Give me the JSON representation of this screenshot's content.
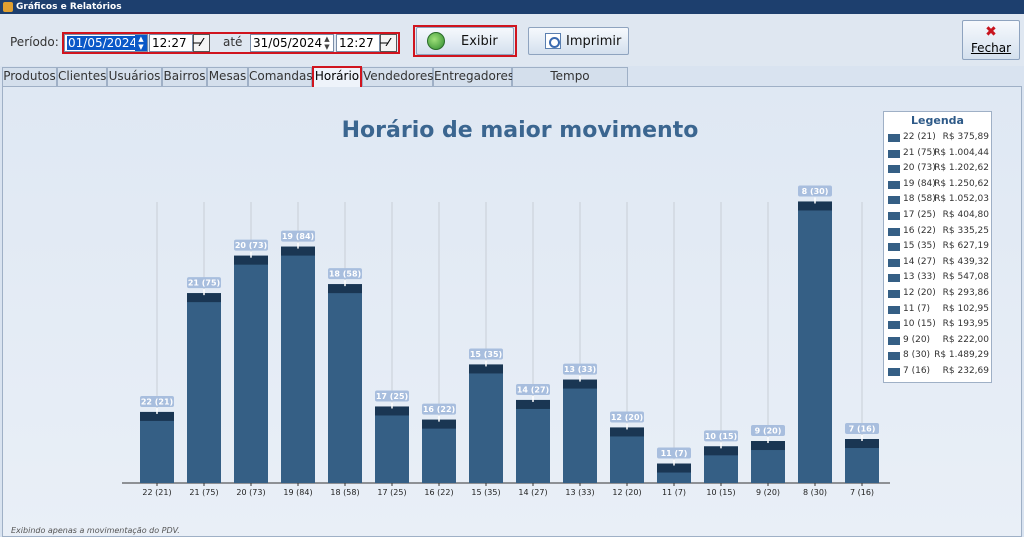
{
  "window": {
    "title": "Gráficos e Relatórios"
  },
  "toolbar": {
    "periodo_label": "Período:",
    "start_date": "01/05/2024",
    "start_time": "12:27",
    "ate_label": "até",
    "end_date": "31/05/2024",
    "end_time": "12:27",
    "calendar_glyph": "⁄̶",
    "exibir_label": "Exibir",
    "imprimir_label": "Imprimir",
    "fechar_label": "Fechar",
    "fechar_glyph": "✖"
  },
  "tabs": [
    "Produtos",
    "Clientes",
    "Usuários",
    "Bairros",
    "Mesas",
    "Comandas",
    "Horário",
    "Vendedores",
    "Entregadores",
    "Tempo Atendimento"
  ],
  "active_tab": "Horário",
  "chart_data": {
    "type": "bar",
    "title": "Horário de maior movimento",
    "categories": [
      "22 (21)",
      "21 (75)",
      "20 (73)",
      "19 (84)",
      "18 (58)",
      "17 (25)",
      "16 (22)",
      "15 (35)",
      "14 (27)",
      "13 (33)",
      "12 (20)",
      "11 (7)",
      "10 (15)",
      "9 (20)",
      "8 (30)",
      "7 (16)"
    ],
    "values": [
      375.89,
      1004.44,
      1202.62,
      1250.62,
      1052.03,
      404.8,
      335.25,
      627.19,
      439.32,
      547.08,
      293.86,
      102.95,
      193.95,
      222.0,
      1489.29,
      232.69
    ],
    "color": "#355f85",
    "ylim": [
      0,
      1550
    ],
    "grid": "vertical",
    "legend": {
      "title": "Legenda",
      "placement": "right",
      "entries": [
        {
          "name": "22 (21)",
          "value": "R$ 375,89"
        },
        {
          "name": "21 (75)",
          "value": "R$ 1.004,44"
        },
        {
          "name": "20 (73)",
          "value": "R$ 1.202,62"
        },
        {
          "name": "19 (84)",
          "value": "R$ 1.250,62"
        },
        {
          "name": "18 (58)",
          "value": "R$ 1.052,03"
        },
        {
          "name": "17 (25)",
          "value": "R$ 404,80"
        },
        {
          "name": "16 (22)",
          "value": "R$ 335,25"
        },
        {
          "name": "15 (35)",
          "value": "R$ 627,19"
        },
        {
          "name": "14 (27)",
          "value": "R$ 439,32"
        },
        {
          "name": "13 (33)",
          "value": "R$ 547,08"
        },
        {
          "name": "12 (20)",
          "value": "R$ 293,86"
        },
        {
          "name": "11 (7)",
          "value": "R$ 102,95"
        },
        {
          "name": "10 (15)",
          "value": "R$ 193,95"
        },
        {
          "name": "9 (20)",
          "value": "R$ 222,00"
        },
        {
          "name": "8 (30)",
          "value": "R$ 1.489,29"
        },
        {
          "name": "7 (16)",
          "value": "R$ 232,69"
        }
      ]
    }
  },
  "footer": "Exibindo apenas a movimentação do PDV."
}
